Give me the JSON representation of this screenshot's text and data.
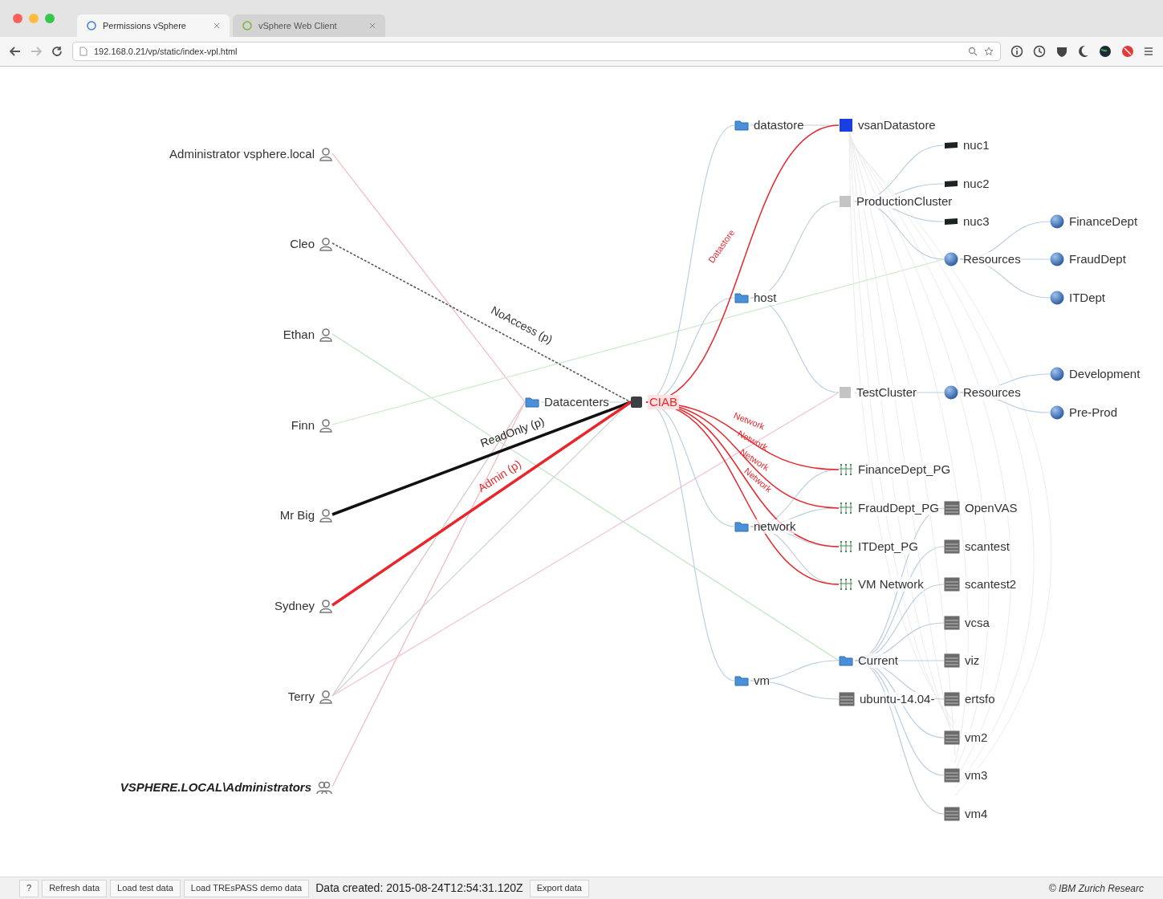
{
  "browser": {
    "tabs": [
      {
        "title": "Permissions vSphere",
        "selected": true
      },
      {
        "title": "vSphere Web Client",
        "selected": false
      }
    ],
    "url": "192.168.0.21/vp/static/index-vpl.html"
  },
  "users": [
    {
      "name": "Administrator vsphere.local",
      "kind": "user"
    },
    {
      "name": "Cleo",
      "kind": "user"
    },
    {
      "name": "Ethan",
      "kind": "user"
    },
    {
      "name": "Finn",
      "kind": "user"
    },
    {
      "name": "Mr Big",
      "kind": "user"
    },
    {
      "name": "Sydney",
      "kind": "user"
    },
    {
      "name": "Terry",
      "kind": "user"
    },
    {
      "name": "VSPHERE.LOCAL\\Administrators",
      "kind": "group"
    }
  ],
  "inventory": [
    {
      "name": "Datacenters",
      "kind": "folder",
      "children": [
        {
          "name": "CIAB",
          "kind": "datacenter",
          "children": [
            {
              "name": "datastore",
              "kind": "folder",
              "children": [
                {
                  "name": "vsanDatastore",
                  "kind": "datastore"
                }
              ]
            },
            {
              "name": "host",
              "kind": "folder",
              "children": [
                {
                  "name": "ProductionCluster",
                  "kind": "cluster",
                  "children": [
                    {
                      "name": "nuc1",
                      "kind": "host"
                    },
                    {
                      "name": "nuc2",
                      "kind": "host"
                    },
                    {
                      "name": "nuc3",
                      "kind": "host"
                    },
                    {
                      "name": "Resources",
                      "kind": "pool",
                      "children": [
                        {
                          "name": "FinanceDept",
                          "kind": "pool"
                        },
                        {
                          "name": "FraudDept",
                          "kind": "pool"
                        },
                        {
                          "name": "ITDept",
                          "kind": "pool"
                        }
                      ]
                    }
                  ]
                },
                {
                  "name": "TestCluster",
                  "kind": "cluster",
                  "children": [
                    {
                      "name": "Resources",
                      "kind": "pool",
                      "children": [
                        {
                          "name": "Development",
                          "kind": "pool"
                        },
                        {
                          "name": "Pre-Prod",
                          "kind": "pool"
                        }
                      ]
                    }
                  ]
                }
              ]
            },
            {
              "name": "network",
              "kind": "folder",
              "children": [
                {
                  "name": "FinanceDept_PG",
                  "kind": "portgroup"
                },
                {
                  "name": "FraudDept_PG",
                  "kind": "portgroup"
                },
                {
                  "name": "ITDept_PG",
                  "kind": "portgroup"
                },
                {
                  "name": "VM Network",
                  "kind": "portgroup"
                }
              ]
            },
            {
              "name": "vm",
              "kind": "folder",
              "children": [
                {
                  "name": "Current",
                  "kind": "folder",
                  "children": [
                    {
                      "name": "OpenVAS",
                      "kind": "vm"
                    },
                    {
                      "name": "scantest",
                      "kind": "vm"
                    },
                    {
                      "name": "scantest2",
                      "kind": "vm"
                    },
                    {
                      "name": "vcsa",
                      "kind": "vm"
                    },
                    {
                      "name": "viz",
                      "kind": "vm"
                    },
                    {
                      "name": "ertsfo",
                      "kind": "vm"
                    },
                    {
                      "name": "vm2",
                      "kind": "vm"
                    },
                    {
                      "name": "vm3",
                      "kind": "vm"
                    },
                    {
                      "name": "vm4",
                      "kind": "vm"
                    }
                  ]
                },
                {
                  "name": "ubuntu-14.04-",
                  "kind": "vm"
                }
              ]
            }
          ]
        }
      ]
    }
  ],
  "permissions": [
    {
      "label": "NoAccess (p)",
      "kind": "noaccess"
    },
    {
      "label": "ReadOnly (p)",
      "kind": "readonly"
    },
    {
      "label": "Admin (p)",
      "kind": "admin"
    },
    {
      "label": "Datastore",
      "kind": "admin"
    },
    {
      "label": "Network",
      "kind": "admin"
    },
    {
      "label": "Network",
      "kind": "admin"
    },
    {
      "label": "Network",
      "kind": "admin"
    },
    {
      "label": "Network",
      "kind": "admin"
    }
  ],
  "footer": {
    "buttons": [
      "?",
      "Refresh data",
      "Load test data",
      "Load TREsPASS demo data"
    ],
    "info": "Data created: 2015-08-24T12:54:31.120Z",
    "export_button": "Export data",
    "credit": "© IBM Zurich Researc"
  }
}
